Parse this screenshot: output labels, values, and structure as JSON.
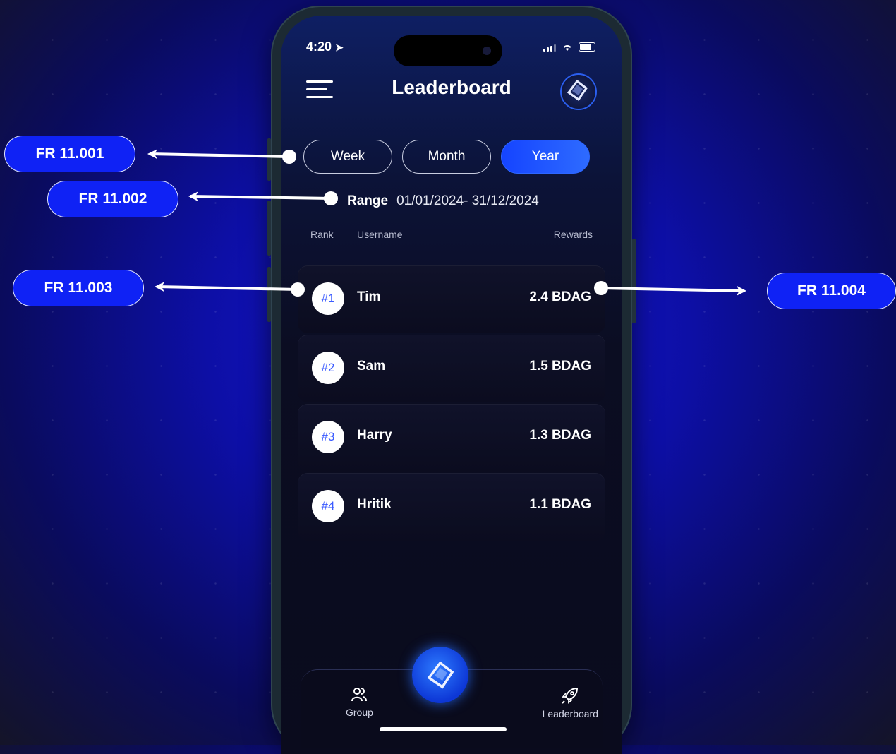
{
  "status": {
    "time": "4:20"
  },
  "header": {
    "title": "Leaderboard",
    "menu_icon": "hamburger-icon",
    "logo_icon": "cube-logo-icon"
  },
  "tabs": [
    {
      "label": "Week",
      "active": false
    },
    {
      "label": "Month",
      "active": false
    },
    {
      "label": "Year",
      "active": true
    }
  ],
  "range": {
    "label": "Range",
    "value": "01/01/2024- 31/12/2024"
  },
  "columns": {
    "rank": "Rank",
    "username": "Username",
    "rewards": "Rewards"
  },
  "rows": [
    {
      "rank": "#1",
      "name": "Tim",
      "reward": "2.4 BDAG"
    },
    {
      "rank": "#2",
      "name": "Sam",
      "reward": "1.5 BDAG"
    },
    {
      "rank": "#3",
      "name": "Harry",
      "reward": "1.3 BDAG"
    },
    {
      "rank": "#4",
      "name": "Hritik",
      "reward": "1.1 BDAG"
    }
  ],
  "nav": {
    "group_label": "Group",
    "leaderboard_label": "Leaderboard"
  },
  "annotations": {
    "a1": "FR 11.001",
    "a2": "FR 11.002",
    "a3": "FR 11.003",
    "a4": "FR 11.004"
  },
  "colors": {
    "accent": "#1544ff",
    "pill": "#0f22f5"
  }
}
